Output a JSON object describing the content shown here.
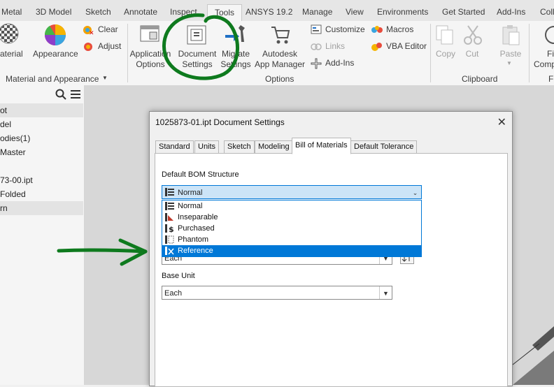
{
  "ribbon_tabs": [
    "Metal",
    "3D Model",
    "Sketch",
    "Annotate",
    "Inspect",
    "Tools",
    "ANSYS 19.2",
    "Manage",
    "View",
    "Environments",
    "Get Started",
    "Add-Ins",
    "Coll"
  ],
  "active_tab": "Tools",
  "material_panel": {
    "material_label": "aterial",
    "appearance_label": "Appearance",
    "clear_label": "Clear",
    "adjust_label": "Adjust",
    "title": "Material and Appearance",
    "dropdown_glyph": "▼"
  },
  "options_panel": {
    "application_options": [
      "Application",
      "Options"
    ],
    "document_settings": [
      "Document",
      "Settings"
    ],
    "migrate_settings": [
      "Migrate",
      "Settings"
    ],
    "app_manager": [
      "Autodesk",
      "App Manager"
    ],
    "customize_label": "Customize",
    "links_label": "Links",
    "addins_label": "Add-Ins",
    "macros_label": "Macros",
    "vba_label": "VBA Editor",
    "title": "Options"
  },
  "clipboard_panel": {
    "copy_label": "Copy",
    "cut_label": "Cut",
    "paste_label": "Paste",
    "title": "Clipboard"
  },
  "right_cut": {
    "fi": "Fi",
    "comp": "Comp",
    "f": "Fi"
  },
  "browser": {
    "items": [
      "ot",
      "del",
      "odies(1)",
      "Master",
      "",
      "73-00.ipt",
      "Folded",
      "rn"
    ]
  },
  "dialog": {
    "title": "1025873-01.ipt Document Settings",
    "close": "✕",
    "tabs": [
      "Standard",
      "Units",
      "Sketch",
      "Modeling",
      "Bill of Materials",
      "Default Tolerance"
    ],
    "active_tab": "Bill of Materials",
    "bom_structure_label": "Default BOM Structure",
    "bom_structure_value": "Normal",
    "bom_options": [
      "Normal",
      "Inseparable",
      "Purchased",
      "Phantom",
      "Reference"
    ],
    "bom_selected": "Reference",
    "quantity_value": "Each",
    "base_unit_label": "Base Unit",
    "base_unit_value": "Each"
  },
  "colors": {
    "accent": "#0078d7",
    "annotation": "#0e7a1e"
  }
}
